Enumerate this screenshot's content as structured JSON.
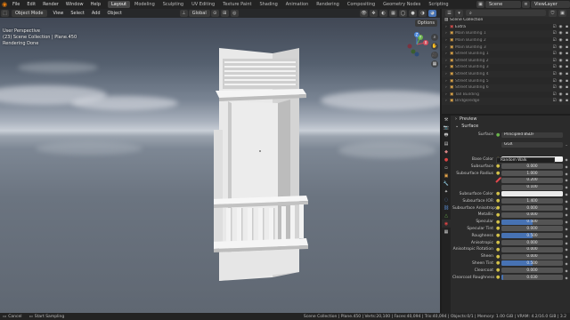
{
  "topbar": {
    "menus": [
      "File",
      "Edit",
      "Render",
      "Window",
      "Help"
    ],
    "workspaces": [
      {
        "label": "Layout",
        "active": true
      },
      {
        "label": "Modeling",
        "active": false
      },
      {
        "label": "Sculpting",
        "active": false
      },
      {
        "label": "UV Editing",
        "active": false
      },
      {
        "label": "Texture Paint",
        "active": false
      },
      {
        "label": "Shading",
        "active": false
      },
      {
        "label": "Animation",
        "active": false
      },
      {
        "label": "Rendering",
        "active": false
      },
      {
        "label": "Compositing",
        "active": false
      },
      {
        "label": "Geometry Nodes",
        "active": false
      },
      {
        "label": "Scripting",
        "active": false
      }
    ],
    "scene": "Scene",
    "view_layer": "ViewLayer"
  },
  "viewport": {
    "mode": "Object Mode",
    "menus": [
      "View",
      "Select",
      "Add",
      "Object"
    ],
    "transform_orientation": "Global",
    "options_label": "Options",
    "info": {
      "line1": "User Perspective",
      "line2": "(23) Scene Collection | Plane.450",
      "line3": "Rendering Done"
    },
    "gizmo": {
      "x_label": "X",
      "y_label": "Y",
      "z_label": "Z"
    }
  },
  "outliner": {
    "root": "Scene Collection",
    "items": [
      {
        "label": "Extra",
        "color": "#d44d4d"
      },
      {
        "label": "Main Building 1",
        "color": "#e0a74a"
      },
      {
        "label": "Main Building 2",
        "color": "#e0a74a"
      },
      {
        "label": "Main Building 3",
        "color": "#e0a74a"
      },
      {
        "label": "Street Building 1",
        "color": "#e0a74a"
      },
      {
        "label": "Street Building 2",
        "color": "#e0a74a"
      },
      {
        "label": "Street Building 3",
        "color": "#e0a74a"
      },
      {
        "label": "Street Building 4",
        "color": "#e0a74a"
      },
      {
        "label": "Street Building 5",
        "color": "#e0a74a"
      },
      {
        "label": "Street Building 6",
        "color": "#e0a74a"
      },
      {
        "label": "Tall Building",
        "color": "#e0a74a"
      },
      {
        "label": "Bridge/edge",
        "color": "#e0a74a"
      }
    ]
  },
  "properties": {
    "sections": {
      "preview": "Preview",
      "surface": "Surface"
    },
    "surface_label": "Surface",
    "surface_value": "Principled BSDF",
    "distribution": "GGX",
    "subsurface_method": "Random Walk",
    "rows": [
      {
        "label": "Base Color",
        "kind": "color",
        "value": ""
      },
      {
        "label": "Subsurface",
        "kind": "num",
        "value": "0.000",
        "fill": 0
      },
      {
        "label": "Subsurface Radius",
        "kind": "num",
        "value": "1.000",
        "fill": 0
      },
      {
        "label": "",
        "kind": "num",
        "value": "0.200",
        "fill": 0
      },
      {
        "label": "",
        "kind": "num",
        "value": "0.100",
        "fill": 0
      },
      {
        "label": "Subsurface Color",
        "kind": "color",
        "value": ""
      },
      {
        "label": "Subsurface IOR",
        "kind": "num",
        "value": "1.400",
        "fill": 0
      },
      {
        "label": "Subsurface Anisotropy",
        "kind": "num",
        "value": "0.000",
        "fill": 0
      },
      {
        "label": "Metallic",
        "kind": "num",
        "value": "0.000",
        "fill": 0
      },
      {
        "label": "Specular",
        "kind": "num",
        "value": "0.500",
        "fill": 0.5
      },
      {
        "label": "Specular Tint",
        "kind": "num",
        "value": "0.000",
        "fill": 0
      },
      {
        "label": "Roughness",
        "kind": "num",
        "value": "0.500",
        "fill": 0.5
      },
      {
        "label": "Anisotropic",
        "kind": "num",
        "value": "0.000",
        "fill": 0
      },
      {
        "label": "Anisotropic Rotation",
        "kind": "num",
        "value": "0.000",
        "fill": 0
      },
      {
        "label": "Sheen",
        "kind": "num",
        "value": "0.000",
        "fill": 0
      },
      {
        "label": "Sheen Tint",
        "kind": "num",
        "value": "0.500",
        "fill": 0.5
      },
      {
        "label": "Clearcoat",
        "kind": "num",
        "value": "0.000",
        "fill": 0
      },
      {
        "label": "Clearcoat Roughness",
        "kind": "num",
        "value": "0.030",
        "fill": 0.03
      }
    ]
  },
  "statusbar": {
    "left1": "Cancel",
    "left2": "Start Sampling",
    "right": "Scene Collection | Plane.450 | Verts:20,100 | Faces:40,094 | Tris:40,094 | Objects:0/1 | Memory: 1.00 GiB | VRAM: 4.2/16.0 GiB | 3.2"
  }
}
